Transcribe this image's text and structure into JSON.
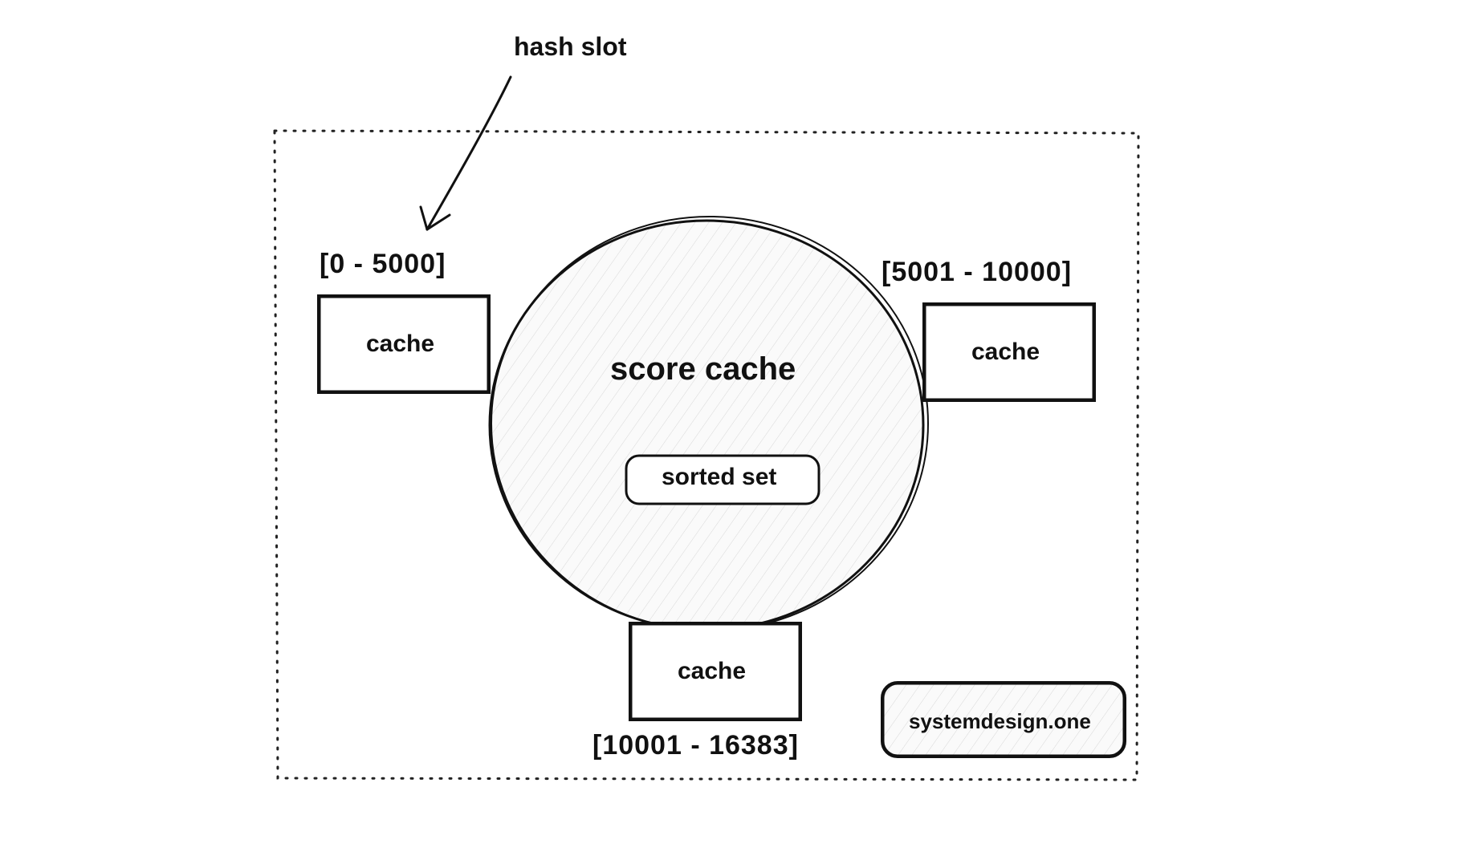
{
  "annotation": {
    "hash_slot": "hash slot"
  },
  "center": {
    "title": "score cache",
    "sorted_set": "sorted set"
  },
  "nodes": {
    "left": {
      "range": "[0 - 5000]",
      "label": "cache"
    },
    "right": {
      "range": "[5001 - 10000]",
      "label": "cache"
    },
    "bottom": {
      "range": "[10001 - 16383]",
      "label": "cache"
    }
  },
  "watermark": "systemdesign.one"
}
